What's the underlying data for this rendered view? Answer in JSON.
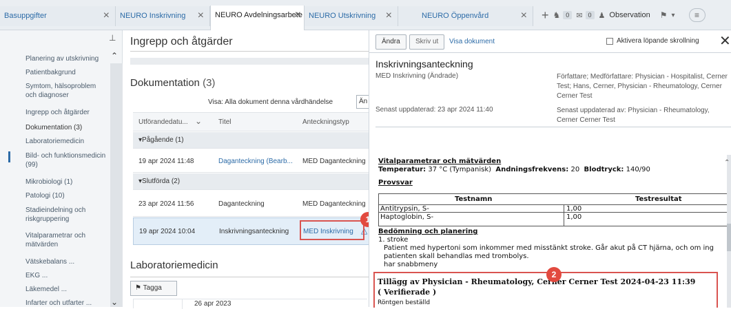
{
  "tabs": [
    {
      "label": "Basuppgifter"
    },
    {
      "label": "NEURO Inskrivning"
    },
    {
      "label": "NEURO Avdelningsarbete"
    },
    {
      "label": "NEURO Utskrivning"
    },
    {
      "label": "NEURO Öppenvård"
    }
  ],
  "toolbar": {
    "badge1": "0",
    "badge2": "0",
    "observation": "Observation"
  },
  "leftnav": {
    "items": [
      "Planering av utskrivning",
      "Patientbakgrund",
      "Symtom, hälsoproblem och diagnoser",
      "Ingrepp och åtgärder",
      "Dokumentation (3)",
      "Laboratoriemedicin",
      "Bild- och funktionsmedicin (99)",
      "Mikrobiologi (1)",
      "Patologi (10)",
      "Stadieindelning och riskgruppering",
      "Vitalparametrar och mätvärden",
      "Vätskebalans ...",
      "EKG ...",
      "Läkemedel ...",
      "Infarter och utfarter ..."
    ]
  },
  "middle": {
    "title": "Ingrepp och åtgärder",
    "doc_heading": "Dokumentation",
    "doc_count": "(3)",
    "filter_label": "Visa: Alla dokument denna vårdhändelse",
    "filter_btn": "Än",
    "col_date": "Utförandedatu...",
    "col_title": "Titel",
    "col_type": "Anteckningstyp",
    "group_ongoing": "Pågående (1)",
    "group_done": "Slutförda (2)",
    "rows": [
      {
        "date": "19 apr 2024 11:48",
        "title": "Daganteckning (Bearb...",
        "type": "MED Daganteckning"
      },
      {
        "date": "23 apr 2024 11:56",
        "title": "Daganteckning",
        "type": "MED Daganteckning"
      },
      {
        "date": "19 apr 2024 10:04",
        "title": "Inskrivningsanteckning",
        "type": "MED Inskrivning"
      }
    ],
    "lab_heading": "Laboratoriemedicin",
    "tag_btn": "Tagga",
    "lab_date": "26 apr 2023"
  },
  "right": {
    "btn_change": "Ändra",
    "btn_print": "Skriv ut",
    "link_view": "Visa dokument",
    "checkbox_label": "Aktivera löpande skrollning",
    "doc_title": "Inskrivningsanteckning",
    "doc_subtitle": "MED Inskrivning (Ändrade)",
    "authors": "Författare; Medförfattare: Physician - Hospitalist, Cerner Test; Hans, Cerner, Physician - Rheumatology, Cerner Cerner Test",
    "updated": "Senast uppdaterad: 23 apr 2024 11:40",
    "updated_by": "Senast uppdaterad av: Physician - Rheumatology, Cerner Cerner Test",
    "vital_heading": "Vitalparametrar och mätvärden",
    "temp_label": "Temperatur:",
    "temp_value": "37 °C (Tympanisk)",
    "resp_label": "Andningsfrekvens:",
    "resp_value": "20",
    "bp_label": "Blodtryck:",
    "bp_value": "140/90",
    "lab_heading": "Provsvar",
    "lab_col1": "Testnamn",
    "lab_col2": "Testresultat",
    "lab_rows": [
      {
        "name": "Antitrypsin, S-",
        "value": "1,00"
      },
      {
        "name": "Haptoglobin, S-",
        "value": "1,00"
      }
    ],
    "assessment_heading": "Bedömning och planering",
    "assessment_item": "1. stroke",
    "assessment_text": "Patient med hypertoni som inkommer med misstänkt stroke. Går akut på CT hjärna, och om ing patienten skall behandlas med trombolys.",
    "assessment_extra": "har snabbmeny",
    "addendum_title": "Tillägg av Physician - Rheumatology, Cerner Cerner Test 2024-04-23 11:39",
    "addendum_status": "( Verifierade )",
    "addendum_text": "Röntgen beställd"
  },
  "callouts": {
    "one": "1",
    "two": "2"
  }
}
